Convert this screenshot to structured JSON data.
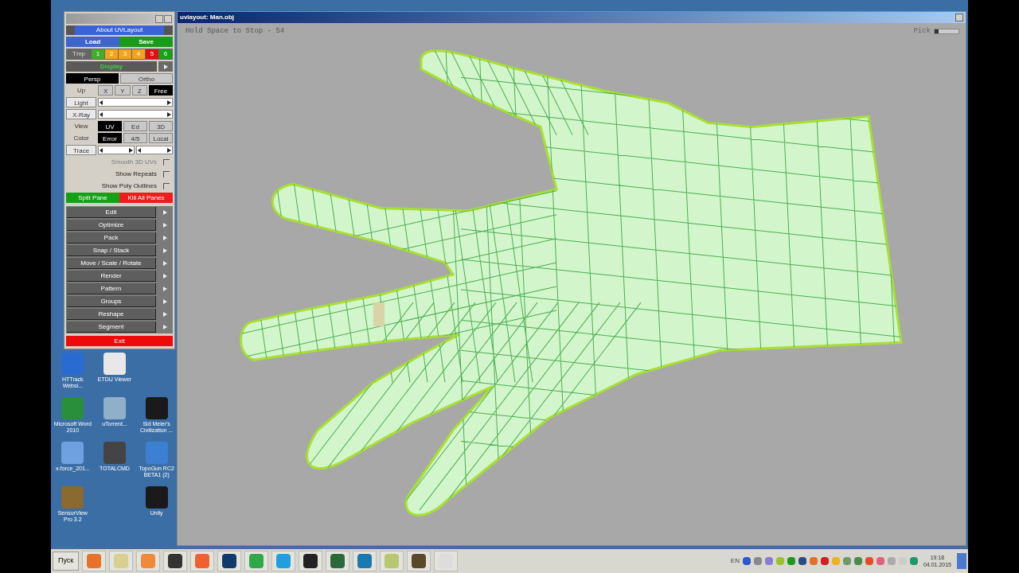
{
  "panel": {
    "about": "About UVLayout",
    "load": "Load",
    "save": "Save",
    "tmp": {
      "label": "Tmp",
      "slots": [
        {
          "label": "1",
          "color": "#3fae2a"
        },
        {
          "label": "2",
          "color": "#f2a51c"
        },
        {
          "label": "3",
          "color": "#f2a51c"
        },
        {
          "label": "4",
          "color": "#f2a51c"
        },
        {
          "label": "5",
          "color": "#e01010"
        },
        {
          "label": "6",
          "color": "#13a313"
        }
      ]
    },
    "display": "Display",
    "projection": [
      {
        "label": "Persp",
        "selected": true
      },
      {
        "label": "Ortho",
        "selected": false
      }
    ],
    "up": {
      "label": "Up",
      "options": [
        {
          "label": "X",
          "selected": false
        },
        {
          "label": "Y",
          "selected": false
        },
        {
          "label": "Z",
          "selected": false
        },
        {
          "label": "Free",
          "selected": true
        }
      ]
    },
    "sliders": [
      {
        "label": "Light"
      },
      {
        "label": "X-Ray"
      }
    ],
    "view": {
      "label": "View",
      "options": [
        {
          "label": "UV",
          "selected": true
        },
        {
          "label": "Ed",
          "selected": false
        },
        {
          "label": "3D",
          "selected": false
        }
      ]
    },
    "color": {
      "label": "Color",
      "options": [
        {
          "label": "Error",
          "selected": true
        },
        {
          "label": "4/5",
          "selected": false
        },
        {
          "label": "Local",
          "selected": false
        }
      ]
    },
    "trace": "Trace",
    "checkboxes": [
      {
        "label": "Smooth 3D UVs",
        "checked": false,
        "disabled": true
      },
      {
        "label": "Show Repeats",
        "checked": false,
        "disabled": false
      },
      {
        "label": "Show Poly Outlines",
        "checked": false,
        "disabled": false
      }
    ],
    "split": "Split Pane",
    "kill": "Kill All Panes",
    "menu": [
      "Edit",
      "Optimize",
      "Pack",
      "Snap / Stack",
      "Move / Scale / Rotate",
      "Render",
      "Pattern",
      "Groups",
      "Reshape",
      "Segment"
    ],
    "exit": "Exit"
  },
  "desktop_icons": [
    {
      "label": "HTTrack Websi..."
    },
    {
      "label": "ETDU Viewer"
    },
    {
      "label": "Microsoft Word 2010"
    },
    {
      "label": "uTorrent..."
    },
    {
      "label": "Sid Meier's Civilization ..."
    },
    {
      "label": "x-force_201..."
    },
    {
      "label": "TOTALCMD"
    },
    {
      "label": "TopoGun RC2 BETA1 (2)"
    },
    {
      "label": "SensorView Pro 3.2"
    },
    {
      "label": "Unity"
    }
  ],
  "viewport": {
    "title": "uvlayout: Man.obj",
    "status": "Hold Space to Stop - 54",
    "pick": {
      "label": "Pick",
      "level": 0.15
    }
  },
  "taskbar": {
    "start": "Пуск",
    "language": "EN",
    "time": "19:18",
    "date": "04.01.2015"
  }
}
